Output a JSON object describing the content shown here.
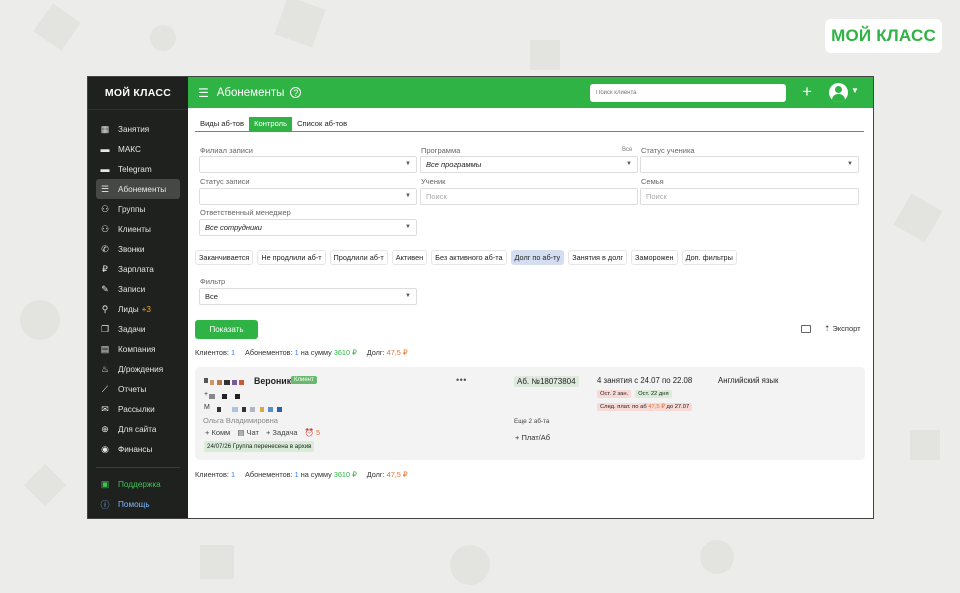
{
  "brand": {
    "badge_text": "МОЙ КЛАСС",
    "sidebar_logo": "МОЙ КЛАСС",
    "accent": "#2fb344"
  },
  "sidebar": {
    "items": [
      {
        "label": "Занятия",
        "icon": "calendar-icon"
      },
      {
        "label": "МАКС",
        "icon": "chat-icon"
      },
      {
        "label": "Telegram",
        "icon": "chat-icon"
      },
      {
        "label": "Абонементы",
        "icon": "ticket-icon",
        "active": true
      },
      {
        "label": "Группы",
        "icon": "group-icon"
      },
      {
        "label": "Клиенты",
        "icon": "clients-icon"
      },
      {
        "label": "Звонки",
        "icon": "phone-icon"
      },
      {
        "label": "Зарплата",
        "icon": "salary-icon"
      },
      {
        "label": "Записи",
        "icon": "edit-icon"
      },
      {
        "label": "Лиды",
        "icon": "leads-icon",
        "badge": "+3"
      },
      {
        "label": "Задачи",
        "icon": "tasks-icon"
      },
      {
        "label": "Компания",
        "icon": "company-icon"
      },
      {
        "label": "Д/рождения",
        "icon": "cake-icon"
      },
      {
        "label": "Отчеты",
        "icon": "chart-icon"
      },
      {
        "label": "Рассылки",
        "icon": "mail-icon"
      },
      {
        "label": "Для сайта",
        "icon": "globe-icon"
      },
      {
        "label": "Финансы",
        "icon": "finance-icon"
      }
    ],
    "support": "Поддержка",
    "help": "Помощь"
  },
  "topbar": {
    "title": "Абонементы",
    "search_placeholder": "Поиск клиента"
  },
  "tabs": [
    "Виды аб-тов",
    "Контроль",
    "Список аб-тов"
  ],
  "filters": {
    "branch_label": "Филиал записи",
    "program_label": "Программа",
    "program_all_link": "Все",
    "program_value": "Все программы",
    "student_status_label": "Статус ученика",
    "record_status_label": "Статус записи",
    "student_label": "Ученик",
    "student_placeholder": "Поиск",
    "family_label": "Семья",
    "family_placeholder": "Поиск",
    "manager_label": "Ответственный менеджер",
    "manager_value": "Все сотрудники",
    "filter_label": "Фильтр",
    "filter_value": "Все"
  },
  "chips": [
    {
      "label": "Заканчивается"
    },
    {
      "label": "Не продлили аб-т"
    },
    {
      "label": "Продлили аб-т"
    },
    {
      "label": "Активен"
    },
    {
      "label": "Без активного аб-та"
    },
    {
      "label": "Долг по аб-ту",
      "active": true
    },
    {
      "label": "Занятия в долг"
    },
    {
      "label": "Заморожен"
    },
    {
      "label": "Доп. фильтры"
    }
  ],
  "show_button": "Показать",
  "export_label": "Экспорт",
  "summary": {
    "clients_label": "Клиентов:",
    "clients_count": "1",
    "subs_label": "Абонементов:",
    "subs_count": "1",
    "sum_label": "на сумму",
    "sum_value": "3610 ₽",
    "debt_label": "Долг:",
    "debt_value": "47,5 ₽"
  },
  "card": {
    "name": "Вероника",
    "client_badge": "Клиент",
    "phone_prefix": "+",
    "email_prefix": "M",
    "teacher": "Ольга Владимировна",
    "actions": {
      "comment": "+ Комм",
      "chat": "Чат",
      "task": "+ Задача",
      "alarm_count": "5"
    },
    "archive_note": "24/07/26 Группа перенесена в архив",
    "sub_number": "Аб. №18073804",
    "more_subs": "Еще 2 аб-та",
    "pay_link": "+ Плат/Аб",
    "lessons": "4 занятия с 24.07 по 22.08",
    "left_lessons": "Ост. 2 зан.",
    "left_days": "Ост. 22 дня",
    "next_pay_prefix": "След. плат. по аб",
    "next_pay_amount": "47,5 ₽",
    "next_pay_suffix": "до 27.07",
    "course": "Английский язык"
  }
}
